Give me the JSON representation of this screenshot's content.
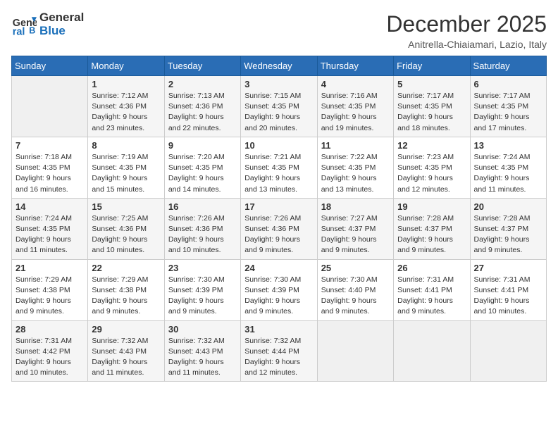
{
  "logo": {
    "line1": "General",
    "line2": "Blue"
  },
  "title": "December 2025",
  "location": "Anitrella-Chiaiamari, Lazio, Italy",
  "days_of_week": [
    "Sunday",
    "Monday",
    "Tuesday",
    "Wednesday",
    "Thursday",
    "Friday",
    "Saturday"
  ],
  "weeks": [
    [
      {
        "day": "",
        "content": ""
      },
      {
        "day": "1",
        "content": "Sunrise: 7:12 AM\nSunset: 4:36 PM\nDaylight: 9 hours\nand 23 minutes."
      },
      {
        "day": "2",
        "content": "Sunrise: 7:13 AM\nSunset: 4:36 PM\nDaylight: 9 hours\nand 22 minutes."
      },
      {
        "day": "3",
        "content": "Sunrise: 7:15 AM\nSunset: 4:35 PM\nDaylight: 9 hours\nand 20 minutes."
      },
      {
        "day": "4",
        "content": "Sunrise: 7:16 AM\nSunset: 4:35 PM\nDaylight: 9 hours\nand 19 minutes."
      },
      {
        "day": "5",
        "content": "Sunrise: 7:17 AM\nSunset: 4:35 PM\nDaylight: 9 hours\nand 18 minutes."
      },
      {
        "day": "6",
        "content": "Sunrise: 7:17 AM\nSunset: 4:35 PM\nDaylight: 9 hours\nand 17 minutes."
      }
    ],
    [
      {
        "day": "7",
        "content": "Sunrise: 7:18 AM\nSunset: 4:35 PM\nDaylight: 9 hours\nand 16 minutes."
      },
      {
        "day": "8",
        "content": "Sunrise: 7:19 AM\nSunset: 4:35 PM\nDaylight: 9 hours\nand 15 minutes."
      },
      {
        "day": "9",
        "content": "Sunrise: 7:20 AM\nSunset: 4:35 PM\nDaylight: 9 hours\nand 14 minutes."
      },
      {
        "day": "10",
        "content": "Sunrise: 7:21 AM\nSunset: 4:35 PM\nDaylight: 9 hours\nand 13 minutes."
      },
      {
        "day": "11",
        "content": "Sunrise: 7:22 AM\nSunset: 4:35 PM\nDaylight: 9 hours\nand 13 minutes."
      },
      {
        "day": "12",
        "content": "Sunrise: 7:23 AM\nSunset: 4:35 PM\nDaylight: 9 hours\nand 12 minutes."
      },
      {
        "day": "13",
        "content": "Sunrise: 7:24 AM\nSunset: 4:35 PM\nDaylight: 9 hours\nand 11 minutes."
      }
    ],
    [
      {
        "day": "14",
        "content": "Sunrise: 7:24 AM\nSunset: 4:35 PM\nDaylight: 9 hours\nand 11 minutes."
      },
      {
        "day": "15",
        "content": "Sunrise: 7:25 AM\nSunset: 4:36 PM\nDaylight: 9 hours\nand 10 minutes."
      },
      {
        "day": "16",
        "content": "Sunrise: 7:26 AM\nSunset: 4:36 PM\nDaylight: 9 hours\nand 10 minutes."
      },
      {
        "day": "17",
        "content": "Sunrise: 7:26 AM\nSunset: 4:36 PM\nDaylight: 9 hours\nand 9 minutes."
      },
      {
        "day": "18",
        "content": "Sunrise: 7:27 AM\nSunset: 4:37 PM\nDaylight: 9 hours\nand 9 minutes."
      },
      {
        "day": "19",
        "content": "Sunrise: 7:28 AM\nSunset: 4:37 PM\nDaylight: 9 hours\nand 9 minutes."
      },
      {
        "day": "20",
        "content": "Sunrise: 7:28 AM\nSunset: 4:37 PM\nDaylight: 9 hours\nand 9 minutes."
      }
    ],
    [
      {
        "day": "21",
        "content": "Sunrise: 7:29 AM\nSunset: 4:38 PM\nDaylight: 9 hours\nand 9 minutes."
      },
      {
        "day": "22",
        "content": "Sunrise: 7:29 AM\nSunset: 4:38 PM\nDaylight: 9 hours\nand 9 minutes."
      },
      {
        "day": "23",
        "content": "Sunrise: 7:30 AM\nSunset: 4:39 PM\nDaylight: 9 hours\nand 9 minutes."
      },
      {
        "day": "24",
        "content": "Sunrise: 7:30 AM\nSunset: 4:39 PM\nDaylight: 9 hours\nand 9 minutes."
      },
      {
        "day": "25",
        "content": "Sunrise: 7:30 AM\nSunset: 4:40 PM\nDaylight: 9 hours\nand 9 minutes."
      },
      {
        "day": "26",
        "content": "Sunrise: 7:31 AM\nSunset: 4:41 PM\nDaylight: 9 hours\nand 9 minutes."
      },
      {
        "day": "27",
        "content": "Sunrise: 7:31 AM\nSunset: 4:41 PM\nDaylight: 9 hours\nand 10 minutes."
      }
    ],
    [
      {
        "day": "28",
        "content": "Sunrise: 7:31 AM\nSunset: 4:42 PM\nDaylight: 9 hours\nand 10 minutes."
      },
      {
        "day": "29",
        "content": "Sunrise: 7:32 AM\nSunset: 4:43 PM\nDaylight: 9 hours\nand 11 minutes."
      },
      {
        "day": "30",
        "content": "Sunrise: 7:32 AM\nSunset: 4:43 PM\nDaylight: 9 hours\nand 11 minutes."
      },
      {
        "day": "31",
        "content": "Sunrise: 7:32 AM\nSunset: 4:44 PM\nDaylight: 9 hours\nand 12 minutes."
      },
      {
        "day": "",
        "content": ""
      },
      {
        "day": "",
        "content": ""
      },
      {
        "day": "",
        "content": ""
      }
    ]
  ]
}
